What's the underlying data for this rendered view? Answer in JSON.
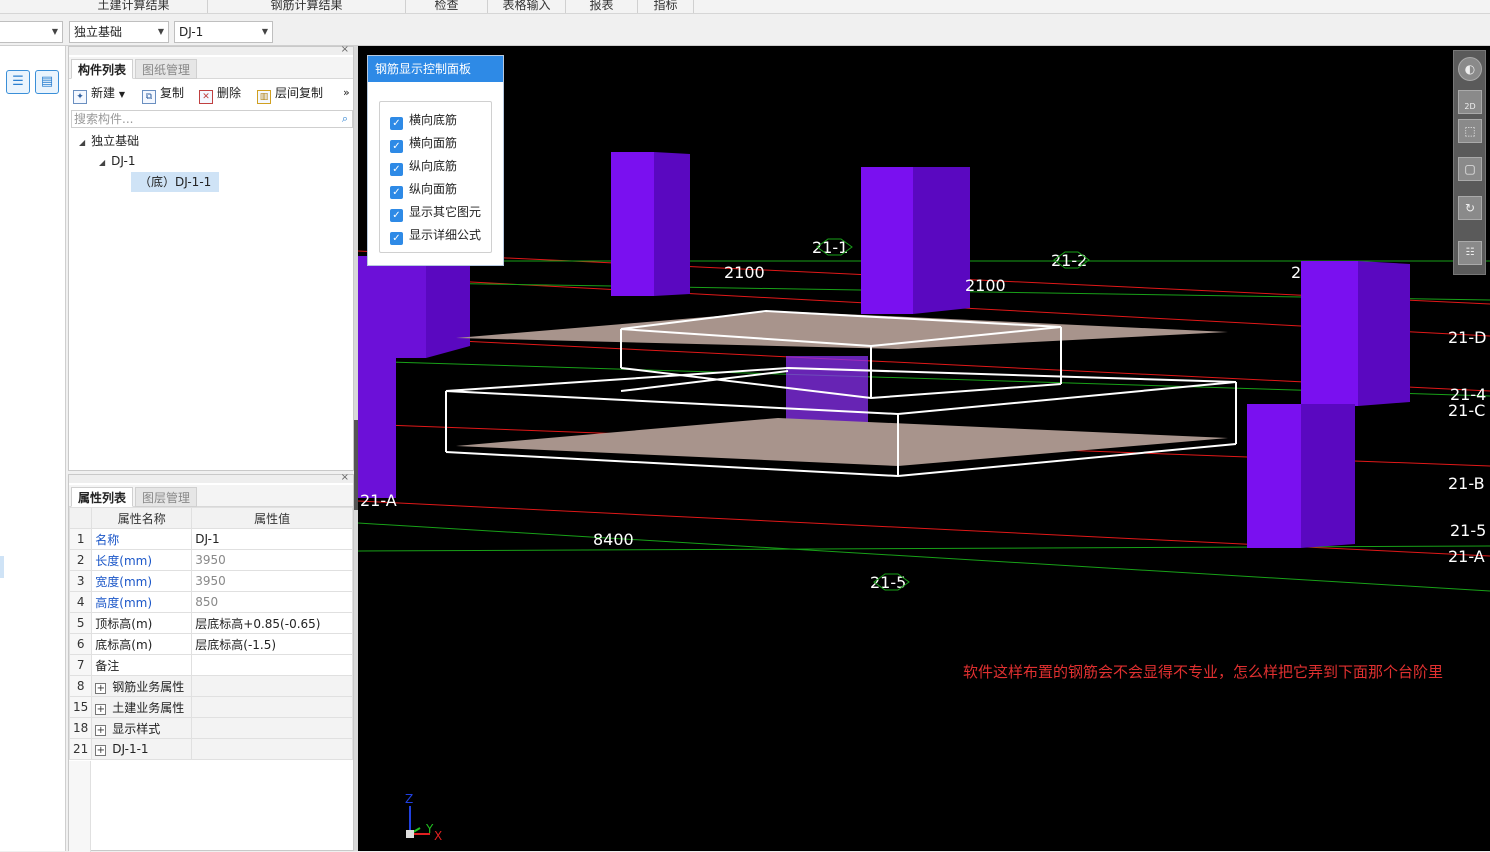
{
  "top_tabs": [
    "土建计算结果",
    "钢筋计算结果",
    "检查",
    "表格输入",
    "报表",
    "指标"
  ],
  "combos": {
    "left": "",
    "type": "独立基础",
    "name": "DJ-1"
  },
  "component_panel": {
    "tabs": [
      "构件列表",
      "图纸管理"
    ],
    "toolbar": {
      "new": "新建",
      "copy": "复制",
      "delete": "删除",
      "floor_copy": "层间复制",
      "more": "»"
    },
    "search_placeholder": "搜索构件...",
    "tree": {
      "root": "独立基础",
      "child": "DJ-1",
      "leaf": "（底）DJ-1-1"
    }
  },
  "property_panel": {
    "tabs": [
      "属性列表",
      "图层管理"
    ],
    "headers": {
      "name": "属性名称",
      "value": "属性值"
    },
    "rows": [
      {
        "num": "1",
        "name": "名称",
        "value": "DJ-1",
        "style": "blue"
      },
      {
        "num": "2",
        "name": "长度(mm)",
        "value": "3950",
        "style": "blue-grey"
      },
      {
        "num": "3",
        "name": "宽度(mm)",
        "value": "3950",
        "style": "blue-grey"
      },
      {
        "num": "4",
        "name": "高度(mm)",
        "value": "850",
        "style": "blue-grey"
      },
      {
        "num": "5",
        "name": "顶标高(m)",
        "value": "层底标高+0.85(-0.65)",
        "style": "plain"
      },
      {
        "num": "6",
        "name": "底标高(m)",
        "value": "层底标高(-1.5)",
        "style": "plain"
      },
      {
        "num": "7",
        "name": "备注",
        "value": "",
        "style": "plain"
      },
      {
        "num": "8",
        "name": "钢筋业务属性",
        "value": "",
        "style": "group"
      },
      {
        "num": "15",
        "name": "土建业务属性",
        "value": "",
        "style": "group"
      },
      {
        "num": "18",
        "name": "显示样式",
        "value": "",
        "style": "group"
      },
      {
        "num": "21",
        "name": "DJ-1-1",
        "value": "",
        "style": "group"
      }
    ]
  },
  "rebar_panel": {
    "title": "钢筋显示控制面板",
    "options": [
      "横向底筋",
      "横向面筋",
      "纵向底筋",
      "纵向面筋",
      "显示其它图元",
      "显示详细公式"
    ]
  },
  "viewport_labels": {
    "dim_2100_a": "2100",
    "dim_2100_b": "2100",
    "dim_8400": "8400",
    "axis_21_1": "21-1",
    "axis_21_2": "21-2",
    "axis_21_5": "21-5",
    "axis_21_D": "21-D",
    "axis_21_4": "21-4",
    "axis_21_C": "21-C",
    "axis_21_B": "21-B",
    "axis_21_5r": "21-5",
    "axis_21_Ar": "21-A",
    "axis_21_A": "21-A",
    "axis_2_partial": "2",
    "z": "Z",
    "y": "Y",
    "x": "X",
    "view_2d": "2D"
  },
  "note": "软件这样布置的钢筋会不会显得不专业，怎么样把它弄到下面那个台阶里",
  "colors": {
    "column": "#7a0ff0",
    "axis_red": "#e01818",
    "axis_green": "#18a018",
    "accent": "#2e8ae6",
    "note": "#e03030"
  }
}
